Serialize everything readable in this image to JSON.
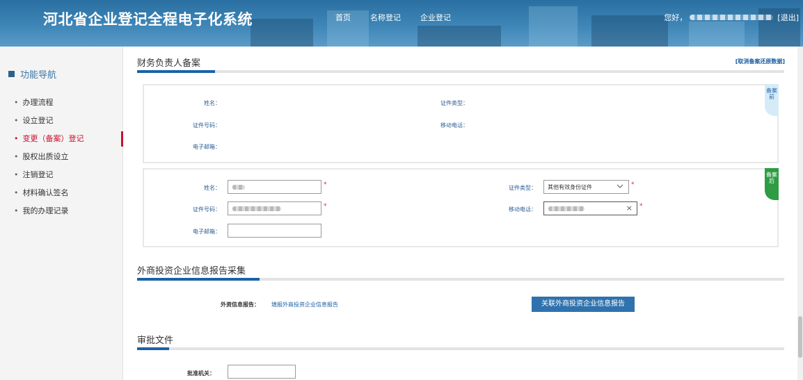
{
  "header": {
    "site_title": "河北省企业登记全程电子化系统",
    "nav": [
      "首页",
      "名称登记",
      "企业登记"
    ],
    "greeting": "您好，",
    "logout": "[退出]"
  },
  "sidebar": {
    "title": "功能导航",
    "items": [
      {
        "label": "办理流程",
        "active": false
      },
      {
        "label": "设立登记",
        "active": false
      },
      {
        "label": "变更（备案）登记",
        "active": true
      },
      {
        "label": "股权出质设立",
        "active": false
      },
      {
        "label": "注销登记",
        "active": false
      },
      {
        "label": "材料确认签名",
        "active": false
      },
      {
        "label": "我的办理记录",
        "active": false
      }
    ]
  },
  "finance_section": {
    "title": "财务负责人备案",
    "cancel_link": "[取消备案还原数据]",
    "before": {
      "tag": "备案前",
      "name_label": "姓名：",
      "id_type_label": "证件类型：",
      "id_no_label": "证件号码：",
      "mobile_label": "移动电话：",
      "email_label": "电子邮箱："
    },
    "after": {
      "tag": "备案后",
      "name_label": "姓名：",
      "id_type_label": "证件类型：",
      "id_type_value": "其他有效身份证件",
      "id_no_label": "证件号码：",
      "mobile_label": "移动电话：",
      "email_label": "电子邮箱：",
      "email_value": "",
      "required_mark": "*",
      "clear_icon": "×"
    }
  },
  "foreign_section": {
    "title": "外商投资企业信息报告采集",
    "label": "外资信息报告：",
    "fill_link": "填报外商投资企业信息报告",
    "assoc_button": "关联外商投资企业信息报告"
  },
  "approval_section": {
    "title": "审批文件",
    "authority_label": "批准机关：",
    "authority_value": ""
  },
  "colors": {
    "accent_blue": "#1a62a8",
    "active_red": "#c8102e",
    "required_red": "#e3262c",
    "tag_green": "#2e9c43"
  }
}
